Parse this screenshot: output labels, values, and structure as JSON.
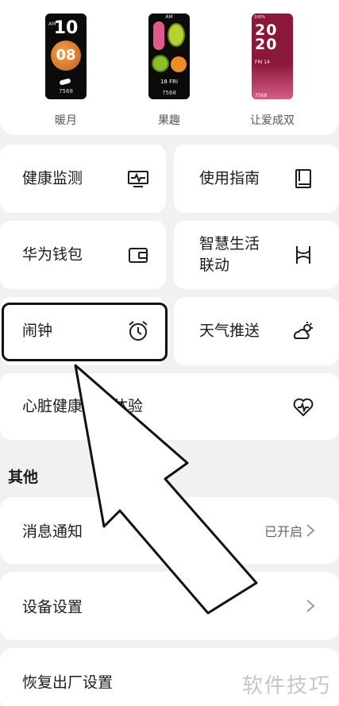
{
  "watch_faces": [
    {
      "label": "暖月",
      "am": "AM",
      "hour": "10",
      "minute": "08",
      "steps": "7568"
    },
    {
      "label": "果趣",
      "am": "AM",
      "date": "18 FRI",
      "steps": "7568"
    },
    {
      "label": "让爱成双",
      "status": "100%",
      "digits_top": "20",
      "digits_bottom": "20",
      "date": "FRI 14",
      "steps": "7568"
    }
  ],
  "tiles": {
    "health_monitor": "健康监测",
    "user_guide": "使用指南",
    "huawei_wallet": "华为钱包",
    "smart_life": "智慧生活\n联动",
    "alarm": "闹钟",
    "weather_push": "天气推送",
    "heart_study": "心脏健康研究体验"
  },
  "section": {
    "other": "其他"
  },
  "rows": {
    "notification_label": "消息通知",
    "notification_value": "已开启",
    "device_settings": "设备设置",
    "factory_reset": "恢复出厂设置"
  },
  "watermark": "软件技巧",
  "icons": [
    "monitor-icon",
    "book-icon",
    "wallet-icon",
    "smart-link-icon",
    "alarm-clock-icon",
    "weather-icon",
    "heart-rate-icon",
    "chevron-right-icon"
  ]
}
